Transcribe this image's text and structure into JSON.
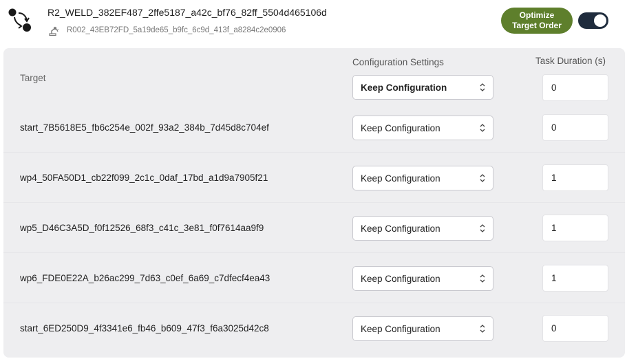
{
  "header": {
    "title": "R2_WELD_382EF487_2ffe5187_a42c_bf76_82ff_5504d465106d",
    "subtitle": "R002_43EB72FD_5a19de65_b9fc_6c9d_413f_a8284c2e0906",
    "optimize_label": "Optimize\nTarget Order",
    "toggle_on": true,
    "icons": {
      "path": "path-nodes-icon",
      "robot": "robot-arm-icon"
    }
  },
  "table": {
    "col_target": "Target",
    "col_config": "Configuration Settings",
    "col_duration": "Task Duration (s)",
    "global": {
      "config": "Keep Configuration",
      "duration": "0"
    },
    "rows": [
      {
        "target": "start_7B5618E5_fb6c254e_002f_93a2_384b_7d45d8c704ef",
        "config": "Keep Configuration",
        "duration": "0"
      },
      {
        "target": "wp4_50FA50D1_cb22f099_2c1c_0daf_17bd_a1d9a7905f21",
        "config": "Keep Configuration",
        "duration": "1"
      },
      {
        "target": "wp5_D46C3A5D_f0f12526_68f3_c41c_3e81_f0f7614aa9f9",
        "config": "Keep Configuration",
        "duration": "1"
      },
      {
        "target": "wp6_FDE0E22A_b26ac299_7d63_c0ef_6a69_c7dfecf4ea43",
        "config": "Keep Configuration",
        "duration": "1"
      },
      {
        "target": "start_6ED250D9_4f3341e6_fb46_b609_47f3_f6a3025d42c8",
        "config": "Keep Configuration",
        "duration": "0"
      }
    ]
  },
  "colors": {
    "accent": "#5e7f2c",
    "toggle": "#1f2c3d",
    "panel": "#eeeef0"
  }
}
